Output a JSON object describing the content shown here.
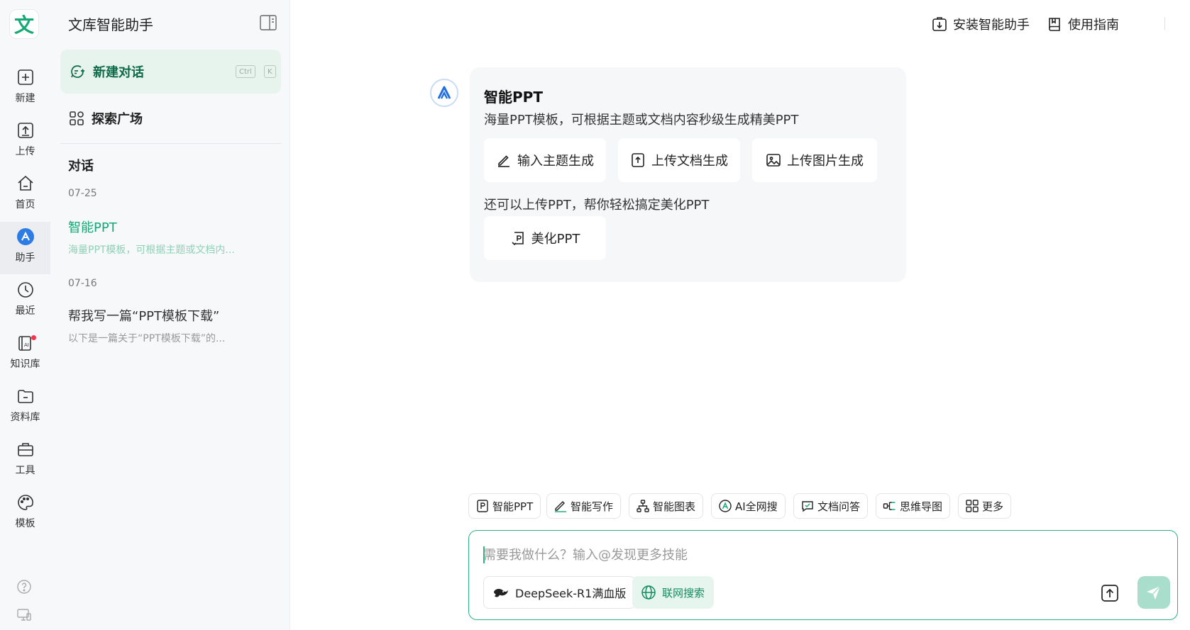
{
  "rail": {
    "logo_char": "文",
    "items": [
      {
        "label": "新建",
        "icon": "plus-square-icon"
      },
      {
        "label": "上传",
        "icon": "upload-icon"
      },
      {
        "label": "首页",
        "icon": "home-icon"
      },
      {
        "label": "助手",
        "icon": "assistant-icon",
        "active": true
      },
      {
        "label": "最近",
        "icon": "clock-icon"
      },
      {
        "label": "知识库",
        "icon": "knowledge-base-icon"
      },
      {
        "label": "资料库",
        "icon": "folder-icon"
      },
      {
        "label": "工具",
        "icon": "toolbox-icon"
      },
      {
        "label": "模板",
        "icon": "palette-icon"
      }
    ]
  },
  "sidebar": {
    "title": "文库智能助手",
    "new_chat": {
      "label": "新建对话",
      "key1": "Ctrl",
      "key2": "K"
    },
    "explore_label": "探索广场",
    "section_title": "对话",
    "groups": [
      {
        "date": "07-25",
        "items": [
          {
            "title": "智能PPT",
            "snippet": "海量PPT模板，可根据主题或文档内...",
            "active": true
          }
        ]
      },
      {
        "date": "07-16",
        "items": [
          {
            "title": "帮我写一篇“PPT模板下载”",
            "snippet": "以下是一篇关于“PPT模板下载”的...",
            "active": false
          }
        ]
      }
    ]
  },
  "header": {
    "install_label": "安装智能助手",
    "guide_label": "使用指南"
  },
  "card": {
    "title": "智能PPT",
    "description": "海量PPT模板，可根据主题或文档内容秒级生成精美PPT",
    "options": [
      "输入主题生成",
      "上传文档生成",
      "上传图片生成"
    ],
    "description2": "还可以上传PPT，帮你轻松搞定美化PPT",
    "beautify_label": "美化PPT"
  },
  "chips": [
    "智能PPT",
    "智能写作",
    "智能图表",
    "AI全网搜",
    "文档问答",
    "思维导图",
    "更多"
  ],
  "input": {
    "placeholder": "需要我做什么？输入@发现更多技能",
    "model_label": "DeepSeek-R1满血版",
    "web_search_label": "联网搜索"
  },
  "colors": {
    "brand_green": "#13a874",
    "active_bg": "#e7f4ee",
    "send_button": "#a8decb",
    "notification_dot": "#f5364a"
  }
}
